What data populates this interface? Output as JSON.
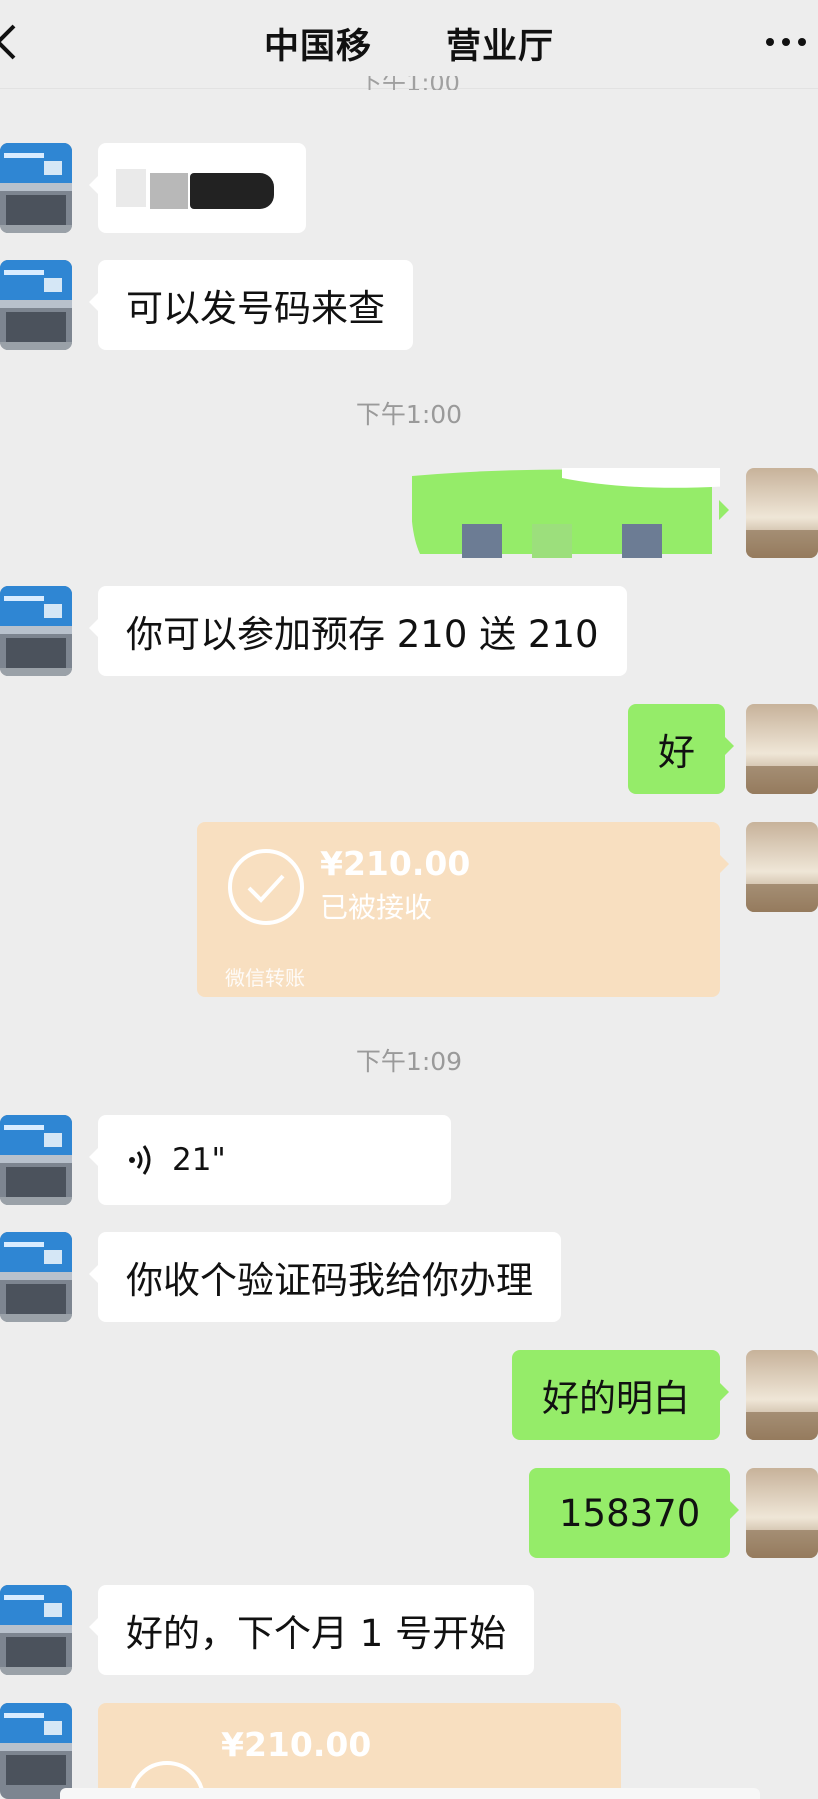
{
  "header": {
    "title_left": "中国移",
    "title_right": "营业厅"
  },
  "timestamps": {
    "first": "下午1:00",
    "second": "下午1:09"
  },
  "messages": {
    "m2": "可以发号码来查",
    "m4": "你可以参加预存 210 送 210",
    "m5": "好",
    "m7": "21\"",
    "m8": "你收个验证码我给你办理",
    "m9": "好的明白",
    "m10": "158370",
    "m11": "好的，下个月 1 号开始"
  },
  "transfer": {
    "amount": "¥210.00",
    "status": "已被接收",
    "label": "微信转账"
  },
  "transfer2": {
    "amount": "¥210.00"
  },
  "colors": {
    "background": "#ededed",
    "outgoing_bubble": "#95ec69",
    "incoming_bubble": "#ffffff",
    "transfer_card": "#f8dfc0"
  }
}
